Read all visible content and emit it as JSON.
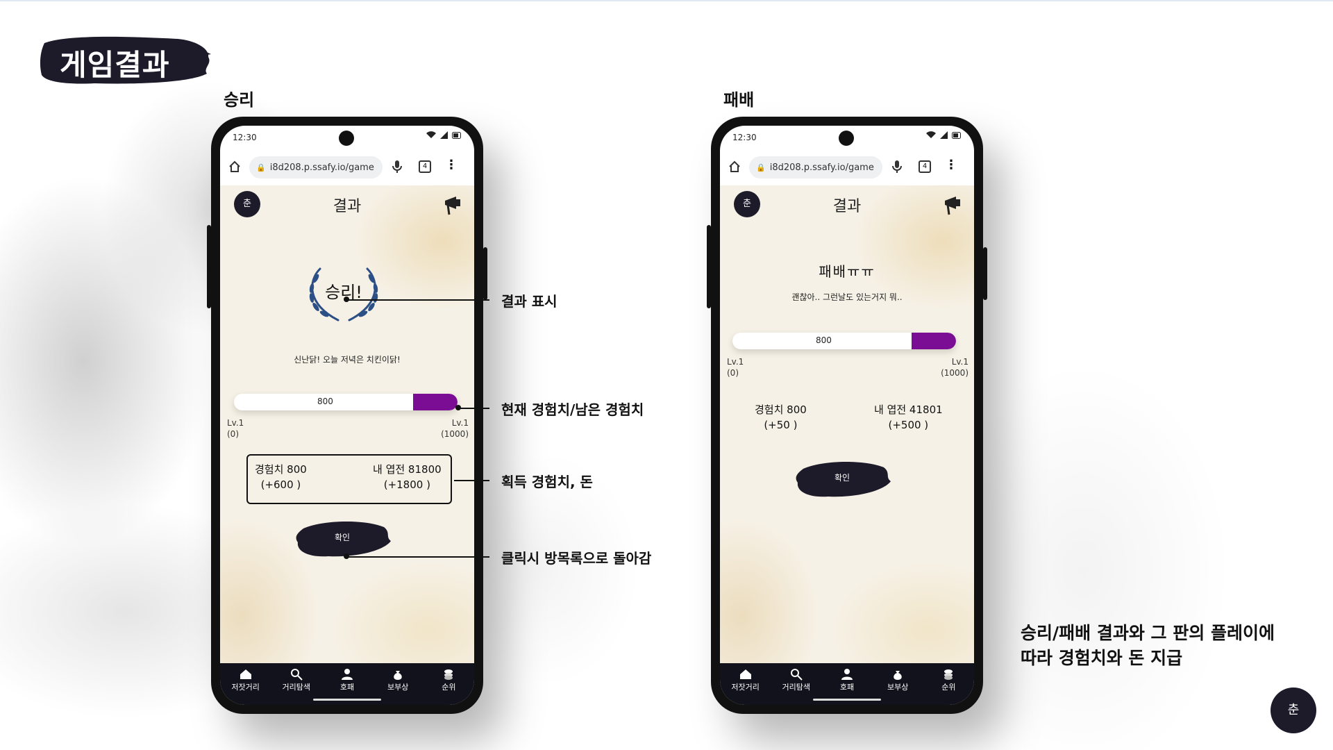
{
  "slide": {
    "title": "게임결과",
    "win_label": "승리",
    "lose_label": "패배",
    "description_line1": "승리/패배 결과와 그 판의 플레이에",
    "description_line2": "따라 경험치와 돈 지급"
  },
  "callouts": {
    "result": "결과 표시",
    "exp_bar": "현재 경험치/남은 경험치",
    "reward": "획득 경험치, 돈",
    "confirm": "클릭시 방목록으로 돌아감"
  },
  "phone_win": {
    "status_time": "12:30",
    "url": "i8d208.p.ssafy.io/game/",
    "tab_count": "4",
    "logo_text": "춘",
    "page_title": "결과",
    "result_text": "승리!",
    "message": "신난닭! 오늘 저녁은 치킨이닭!",
    "exp_value": "800",
    "exp_remaining_fraction": 0.2,
    "lv_left": "Lv.1",
    "lv_left_sub": "(0)",
    "lv_right": "Lv.1",
    "lv_right_sub": "(1000)",
    "reward_exp": "경험치 800",
    "reward_exp_gain": "(+600 )",
    "reward_money": "내 엽전 81800",
    "reward_money_gain": "(+1800 )",
    "confirm_label": "확인",
    "nav": [
      "저잣거리",
      "거리탐색",
      "호패",
      "보부상",
      "순위"
    ]
  },
  "phone_lose": {
    "status_time": "12:30",
    "url": "i8d208.p.ssafy.io/game,",
    "tab_count": "4",
    "logo_text": "춘",
    "page_title": "결과",
    "result_text": "패배ㅠㅠ",
    "message": "괜찮아.. 그런날도 있는거지 뭐..",
    "exp_value": "800",
    "exp_remaining_fraction": 0.2,
    "lv_left": "Lv.1",
    "lv_left_sub": "(0)",
    "lv_right": "Lv.1",
    "lv_right_sub": "(1000)",
    "reward_exp": "경험치 800",
    "reward_exp_gain": "(+50 )",
    "reward_money": "내 엽전 41801",
    "reward_money_gain": "(+500 )",
    "confirm_label": "확인",
    "nav": [
      "저잣거리",
      "거리탐색",
      "호패",
      "보부상",
      "순위"
    ]
  },
  "corner_logo_text": "춘",
  "colors": {
    "exp_fill": "#7a0d93",
    "ink": "#1d1a2a",
    "laurel": "#2c4f86"
  }
}
